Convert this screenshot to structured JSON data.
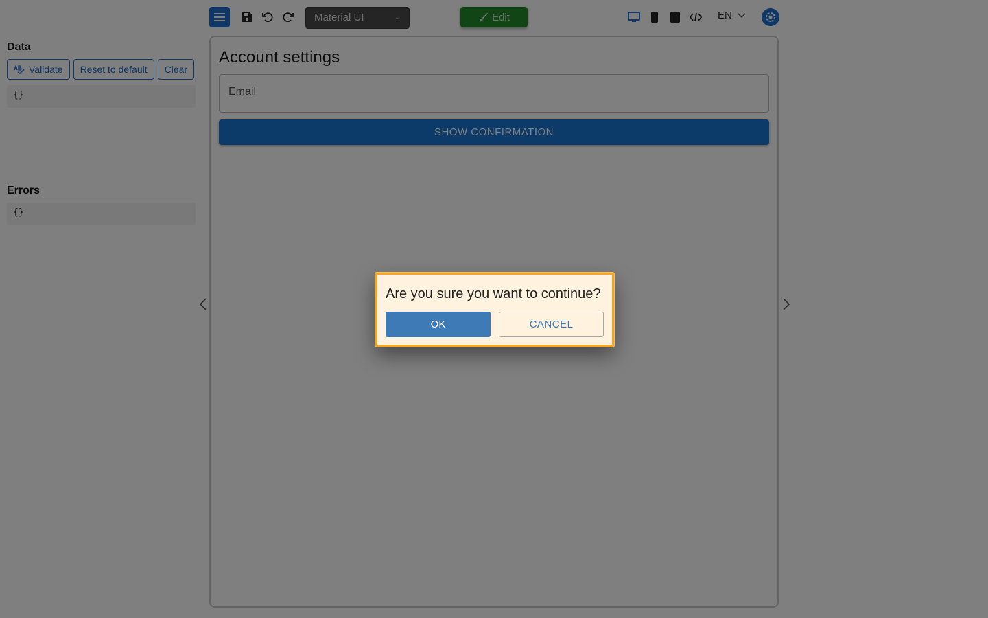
{
  "toolbar": {
    "theme_selector": "Material UI",
    "edit_label": "Edit",
    "language": "EN",
    "icons": [
      "menu-icon",
      "save-icon",
      "undo-icon",
      "redo-icon",
      "desktop-icon",
      "mobile-icon",
      "tablet-icon",
      "code-icon",
      "chevron-down-icon",
      "settings-icon"
    ]
  },
  "left_panel": {
    "data_title": "Data",
    "validate_label": "Validate",
    "reset_label": "Reset to default",
    "clear_label": "Clear",
    "data_value": "{}",
    "errors_title": "Errors",
    "errors_value": "{}"
  },
  "form": {
    "title": "Account settings",
    "email_placeholder": "Email",
    "confirm_button": "SHOW CONFIRMATION"
  },
  "dialog": {
    "message": "Are you sure you want to continue?",
    "ok_label": "OK",
    "cancel_label": "CANCEL"
  },
  "colors": {
    "primary": "#1976d2",
    "edit_green": "#238a2a",
    "dialog_border": "#f5a623",
    "dialog_background": "#fff2de"
  }
}
